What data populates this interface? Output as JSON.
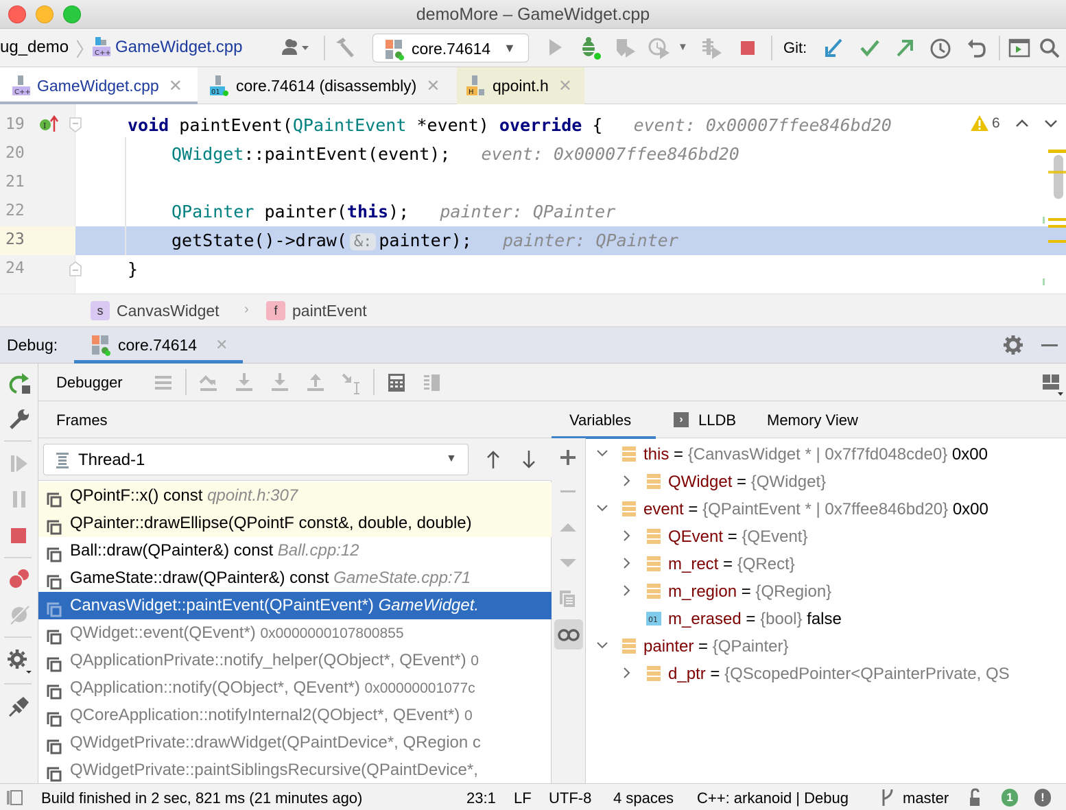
{
  "window": {
    "title": "demoMore – GameWidget.cpp"
  },
  "navbar": {
    "breadcrumb_project": "ug_demo",
    "breadcrumb_file": "GameWidget.cpp",
    "run_config": "core.74614",
    "git_label": "Git:"
  },
  "editor_tabs": [
    {
      "label": "GameWidget.cpp",
      "icon": "cpp-file-icon",
      "active": true
    },
    {
      "label": "core.74614 (disassembly)",
      "icon": "disassembly-icon",
      "active": false
    },
    {
      "label": "qpoint.h",
      "icon": "header-file-icon",
      "active": false
    }
  ],
  "editor": {
    "lines": [
      {
        "num": "19"
      },
      {
        "num": "20"
      },
      {
        "num": "21"
      },
      {
        "num": "22"
      },
      {
        "num": "23"
      },
      {
        "num": "24"
      }
    ],
    "code": {
      "l19_kw1": "void",
      "l19_fn": " paintEvent(",
      "l19_type": "QPaintEvent",
      "l19_rest": " *event) ",
      "l19_kw2": "override",
      "l19_brace": " {",
      "l19_hint": "event: 0x00007ffee846bd20",
      "l20_type": "QWidget",
      "l20_rest": "::paintEvent(event);",
      "l20_hint": "event: 0x00007ffee846bd20",
      "l22_type": "QPainter",
      "l22_mid": " painter(",
      "l22_kw": "this",
      "l22_end": ");",
      "l22_hint": "painter: QPainter",
      "l23_start": "getState()->draw(",
      "l23_param": "&:",
      "l23_end": "painter);",
      "l23_hint": "painter: QPainter",
      "l24": "}"
    },
    "warning_count": "6",
    "current_line": "23"
  },
  "breadcrumbs": {
    "class_badge": "s",
    "class_name": "CanvasWidget",
    "func_badge": "f",
    "func_name": "paintEvent"
  },
  "debug": {
    "label": "Debug:",
    "session_tab": "core.74614",
    "toolbar_label": "Debugger",
    "frames_title": "Frames",
    "thread": "Thread-1",
    "tabs": {
      "variables": "Variables",
      "lldb": "LLDB",
      "memory": "Memory View"
    },
    "frames": [
      {
        "func": "QPointF::x() const ",
        "loc": "qpoint.h:307",
        "addr": "",
        "style": "yellow"
      },
      {
        "func": "QPainter::drawEllipse(QPointF const&, double, double)",
        "loc": "",
        "addr": "",
        "style": "yellow"
      },
      {
        "func": "Ball::draw(QPainter&) const ",
        "loc": "Ball.cpp:12",
        "addr": "",
        "style": "normal"
      },
      {
        "func": "GameState::draw(QPainter&) const ",
        "loc": "GameState.cpp:71",
        "addr": "",
        "style": "normal"
      },
      {
        "func": "CanvasWidget::paintEvent(QPaintEvent*) ",
        "loc": "GameWidget.",
        "addr": "",
        "style": "selected"
      },
      {
        "func": "QWidget::event(QEvent*) ",
        "loc": "",
        "addr": "0x0000000107800855",
        "style": "lib"
      },
      {
        "func": "QApplicationPrivate::notify_helper(QObject*, QEvent*) ",
        "loc": "",
        "addr": "0",
        "style": "lib"
      },
      {
        "func": "QApplication::notify(QObject*, QEvent*) ",
        "loc": "",
        "addr": "0x00000001077c",
        "style": "lib"
      },
      {
        "func": "QCoreApplication::notifyInternal2(QObject*, QEvent*) ",
        "loc": "",
        "addr": "0",
        "style": "lib"
      },
      {
        "func": "QWidgetPrivate::drawWidget(QPaintDevice*, QRegion c",
        "loc": "",
        "addr": "",
        "style": "lib"
      },
      {
        "func": "QWidgetPrivate::paintSiblingsRecursive(QPaintDevice*,",
        "loc": "",
        "addr": "",
        "style": "lib"
      }
    ],
    "variables": [
      {
        "name": "this",
        "eq": " = ",
        "val": "{CanvasWidget * | 0x7f7fd048cde0}",
        "plain": " 0x00",
        "level": 0,
        "expander": "expanded",
        "icon": "field"
      },
      {
        "name": "QWidget",
        "eq": " = ",
        "val": "{QWidget}",
        "plain": "",
        "level": 1,
        "expander": "collapsed",
        "icon": "field"
      },
      {
        "name": "event",
        "eq": " = ",
        "val": "{QPaintEvent * | 0x7ffee846bd20}",
        "plain": " 0x00",
        "level": 0,
        "expander": "expanded",
        "icon": "field"
      },
      {
        "name": "QEvent",
        "eq": " = ",
        "val": "{QEvent}",
        "plain": "",
        "level": 1,
        "expander": "collapsed",
        "icon": "field"
      },
      {
        "name": "m_rect",
        "eq": " = ",
        "val": "{QRect}",
        "plain": "",
        "level": 1,
        "expander": "collapsed",
        "icon": "field"
      },
      {
        "name": "m_region",
        "eq": " = ",
        "val": "{QRegion}",
        "plain": "",
        "level": 1,
        "expander": "collapsed",
        "icon": "field"
      },
      {
        "name": "m_erased",
        "eq": " = ",
        "val": "{bool}",
        "plain": " false",
        "level": 1,
        "expander": "none",
        "icon": "primitive"
      },
      {
        "name": "painter",
        "eq": " = ",
        "val": "{QPainter}",
        "plain": "",
        "level": 0,
        "expander": "expanded",
        "icon": "field"
      },
      {
        "name": "d_ptr",
        "eq": " = ",
        "val": "{QScopedPointer<QPainterPrivate, QS",
        "plain": "",
        "level": 1,
        "expander": "collapsed",
        "icon": "field"
      }
    ]
  },
  "statusbar": {
    "message": "Build finished in 2 sec, 821 ms (21 minutes ago)",
    "position": "23:1",
    "line_sep": "LF",
    "encoding": "UTF-8",
    "indent": "4 spaces",
    "context": "C++: arkanoid | Debug",
    "branch": "master",
    "notifications": "1"
  },
  "colors": {
    "selection": "#2d6cbf",
    "current_line": "#c3d3f0",
    "keyword": "#000080",
    "type": "#008080",
    "var_name": "#7f0000",
    "stop_red": "#db5860",
    "git_blue": "#3592c4",
    "git_green": "#59a869"
  }
}
